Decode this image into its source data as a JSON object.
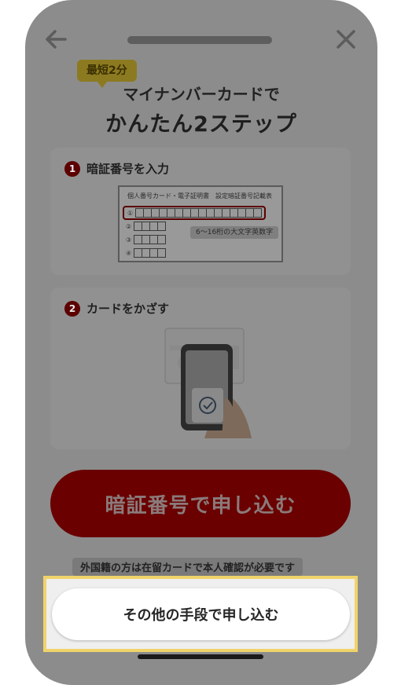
{
  "header": {
    "back_icon": "arrow-left-icon",
    "close_icon": "close-icon"
  },
  "badge": "最短2分",
  "title": {
    "line1": "マイナンバーカードで",
    "line2": "かんたん2ステップ"
  },
  "steps": [
    {
      "number": "1",
      "label": "暗証番号を入力"
    },
    {
      "number": "2",
      "label": "カードをかざす"
    }
  ],
  "form_illustration": {
    "heading": "個人番号カード・電子証明書　設定暗証番号記載表",
    "rows": [
      "①",
      "②",
      "③",
      "④"
    ],
    "hint": "6〜16桁の大文字英数字"
  },
  "primary_button": "暗証番号で申し込む",
  "note": "外国籍の方は在留カードで本人確認が必要です",
  "secondary_button": "その他の手段で申し込む",
  "colors": {
    "overlay_gray": "#8c8c8c",
    "primary_red_dimmed": "#6a0000",
    "highlight_yellow": "#f0d36a"
  }
}
